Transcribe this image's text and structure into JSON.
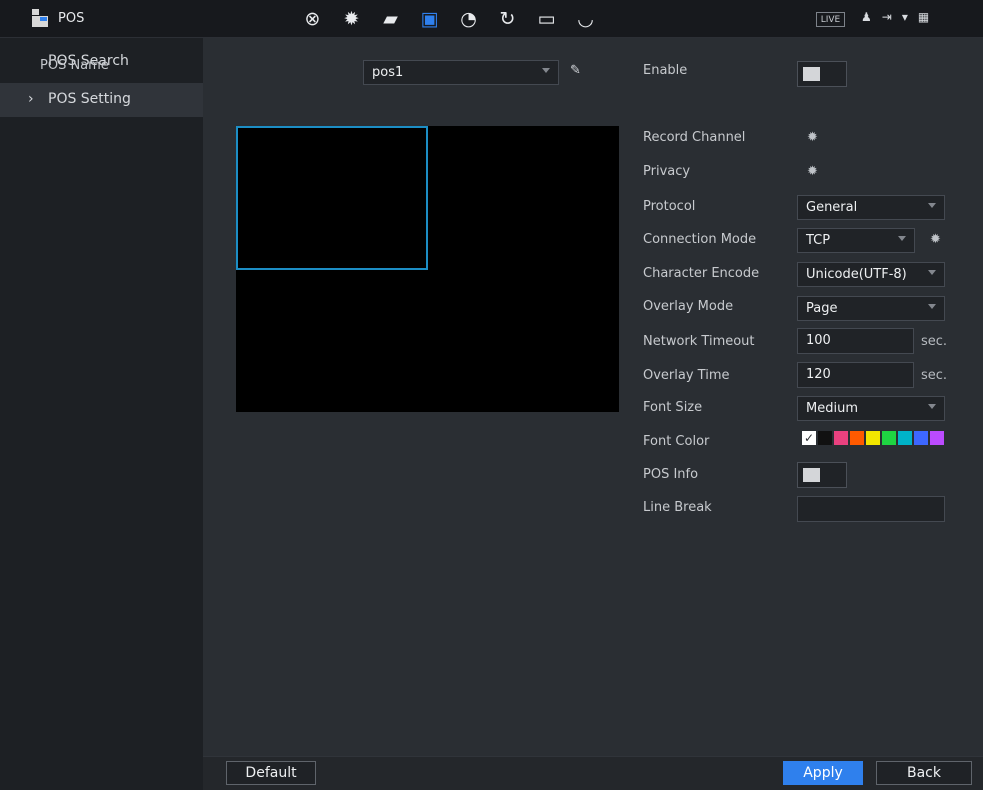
{
  "header": {
    "app_title": "POS",
    "live_label": "LIVE",
    "nav_icons": [
      "camera-icon",
      "network-icon",
      "storage-icon",
      "pos-icon",
      "performance-icon",
      "backup-icon",
      "display-icon",
      "audio-icon"
    ],
    "right_icons": [
      "user-icon",
      "logout-icon",
      "dropdown-icon",
      "grid-icon"
    ]
  },
  "sidebar": {
    "items": [
      {
        "label": "POS Search"
      },
      {
        "label": "POS Setting"
      }
    ]
  },
  "main": {
    "pos_name_label": "POS Name",
    "pos_name_value": "pos1",
    "enable_label": "Enable",
    "record_channel_label": "Record Channel",
    "privacy_label": "Privacy",
    "protocol_label": "Protocol",
    "protocol_value": "General",
    "connection_mode_label": "Connection Mode",
    "connection_mode_value": "TCP",
    "character_encode_label": "Character Encode",
    "character_encode_value": "Unicode(UTF-8)",
    "overlay_mode_label": "Overlay Mode",
    "overlay_mode_value": "Page",
    "network_timeout_label": "Network Timeout",
    "network_timeout_value": "100",
    "network_timeout_unit": "sec.",
    "overlay_time_label": "Overlay Time",
    "overlay_time_value": "120",
    "overlay_time_unit": "sec.",
    "font_size_label": "Font Size",
    "font_size_value": "Medium",
    "font_color_label": "Font Color",
    "font_colors": [
      "#ffffff",
      "#111111",
      "#e9417f",
      "#ff5a00",
      "#f2e600",
      "#1fd442",
      "#00b3c8",
      "#3d67ff",
      "#bb4bff"
    ],
    "pos_info_label": "POS Info",
    "line_break_label": "Line Break"
  },
  "buttons": {
    "default": "Default",
    "apply": "Apply",
    "back": "Back"
  },
  "colors": {
    "accent": "#2f80ed",
    "selection_border": "#1c8ec5"
  }
}
